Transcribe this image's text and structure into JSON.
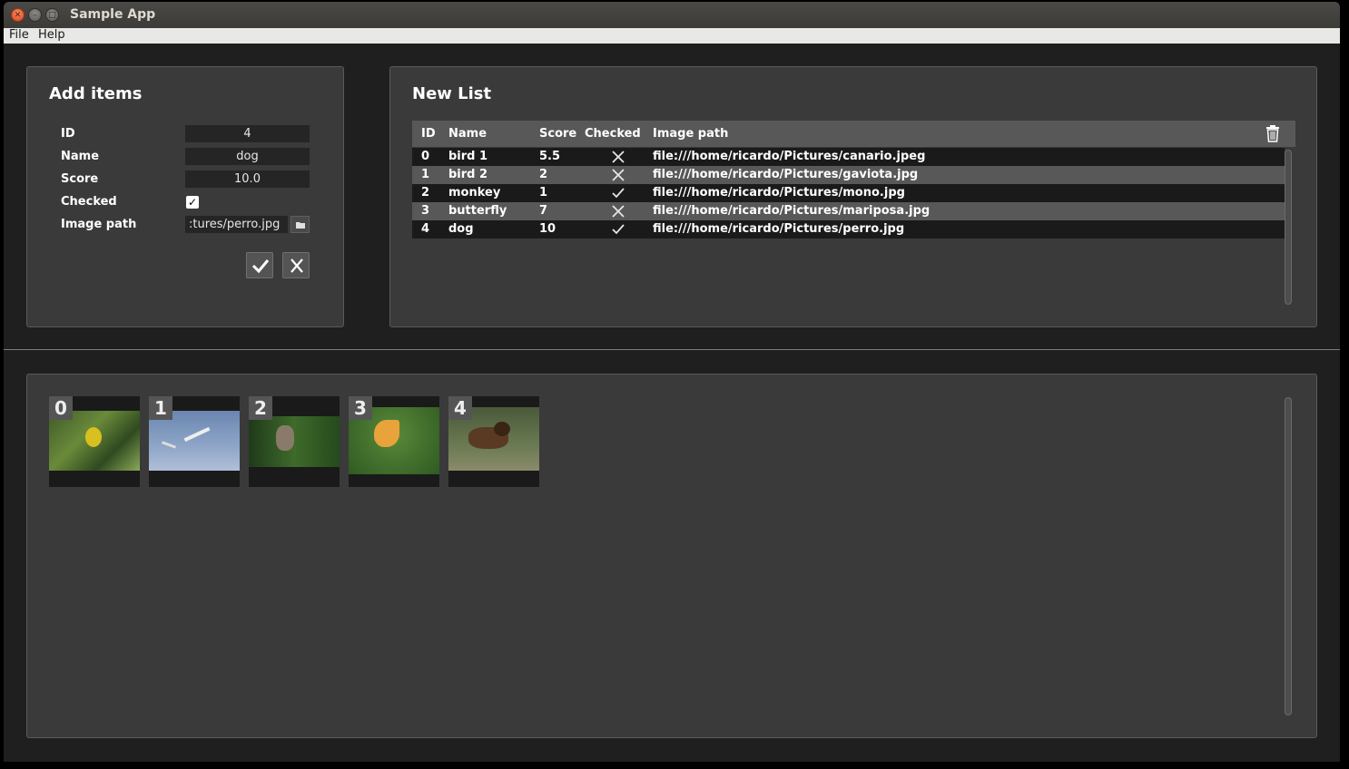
{
  "window": {
    "title": "Sample App"
  },
  "menu": {
    "file": "File",
    "help": "Help"
  },
  "add_items": {
    "title": "Add items",
    "fields": {
      "id_label": "ID",
      "id_value": "4",
      "name_label": "Name",
      "name_value": "dog",
      "score_label": "Score",
      "score_value": "10.0",
      "checked_label": "Checked",
      "checked_value": true,
      "image_path_label": "Image path",
      "image_path_value": ":tures/perro.jpg"
    },
    "buttons": {
      "accept_icon": "checkmark-icon",
      "cancel_icon": "close-icon",
      "browse_icon": "folder-icon"
    }
  },
  "new_list": {
    "title": "New List",
    "columns": [
      "ID",
      "Name",
      "Score",
      "Checked",
      "Image path"
    ],
    "delete_icon": "trash-icon",
    "rows": [
      {
        "id": "0",
        "name": "bird 1",
        "score": "5.5",
        "checked": false,
        "path": "file:///home/ricardo/Pictures/canario.jpeg"
      },
      {
        "id": "1",
        "name": "bird 2",
        "score": "2",
        "checked": false,
        "path": "file:///home/ricardo/Pictures/gaviota.jpg"
      },
      {
        "id": "2",
        "name": "monkey",
        "score": "1",
        "checked": true,
        "path": "file:///home/ricardo/Pictures/mono.jpg"
      },
      {
        "id": "3",
        "name": "butterfly",
        "score": "7",
        "checked": false,
        "path": "file:///home/ricardo/Pictures/mariposa.jpg"
      },
      {
        "id": "4",
        "name": "dog",
        "score": "10",
        "checked": true,
        "path": "file:///home/ricardo/Pictures/perro.jpg"
      }
    ]
  },
  "gallery": {
    "items": [
      {
        "label": "0",
        "subject": "yellow bird photo"
      },
      {
        "label": "1",
        "subject": "seagulls in sky photo"
      },
      {
        "label": "2",
        "subject": "monkey photo"
      },
      {
        "label": "3",
        "subject": "butterfly photo"
      },
      {
        "label": "4",
        "subject": "puppy photo"
      }
    ]
  },
  "colors": {
    "background": "#1f1f1f",
    "panel": "#3a3a3a",
    "header": "#585858",
    "row_dark": "#1a1a1a"
  }
}
